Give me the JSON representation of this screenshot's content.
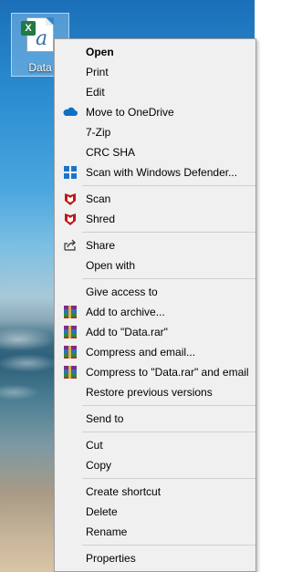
{
  "desktop": {
    "icon_label": "Data",
    "badge_letter": "X",
    "doc_letter": "a"
  },
  "menu": {
    "items": [
      {
        "label": "Open",
        "bold": true,
        "icon": "none"
      },
      {
        "label": "Print",
        "icon": "none"
      },
      {
        "label": "Edit",
        "icon": "none"
      },
      {
        "label": "Move to OneDrive",
        "icon": "onedrive-icon"
      },
      {
        "label": "7-Zip",
        "icon": "none"
      },
      {
        "label": "CRC SHA",
        "icon": "none"
      },
      {
        "label": "Scan with Windows Defender...",
        "icon": "windows-defender-icon"
      },
      {
        "label": "Scan",
        "icon": "mcafee-icon"
      },
      {
        "label": "Shred",
        "icon": "mcafee-icon"
      },
      {
        "label": "Share",
        "icon": "share-icon"
      },
      {
        "label": "Open with",
        "icon": "none"
      },
      {
        "label": "Give access to",
        "icon": "none"
      },
      {
        "label": "Add to archive...",
        "icon": "winrar-icon"
      },
      {
        "label": "Add to \"Data.rar\"",
        "icon": "winrar-icon"
      },
      {
        "label": "Compress and email...",
        "icon": "winrar-icon"
      },
      {
        "label": "Compress to \"Data.rar\" and email",
        "icon": "winrar-icon"
      },
      {
        "label": "Restore previous versions",
        "icon": "none"
      },
      {
        "label": "Send to",
        "icon": "none"
      },
      {
        "label": "Cut",
        "icon": "none"
      },
      {
        "label": "Copy",
        "icon": "none"
      },
      {
        "label": "Create shortcut",
        "icon": "none"
      },
      {
        "label": "Delete",
        "icon": "none"
      },
      {
        "label": "Rename",
        "icon": "none"
      },
      {
        "label": "Properties",
        "icon": "none"
      }
    ]
  },
  "colors": {
    "menu_bg": "#f0f0f0",
    "separator": "#cfcfcf",
    "onedrive": "#0f6fc6",
    "mcafee": "#c01818",
    "excel": "#1f7a43"
  }
}
